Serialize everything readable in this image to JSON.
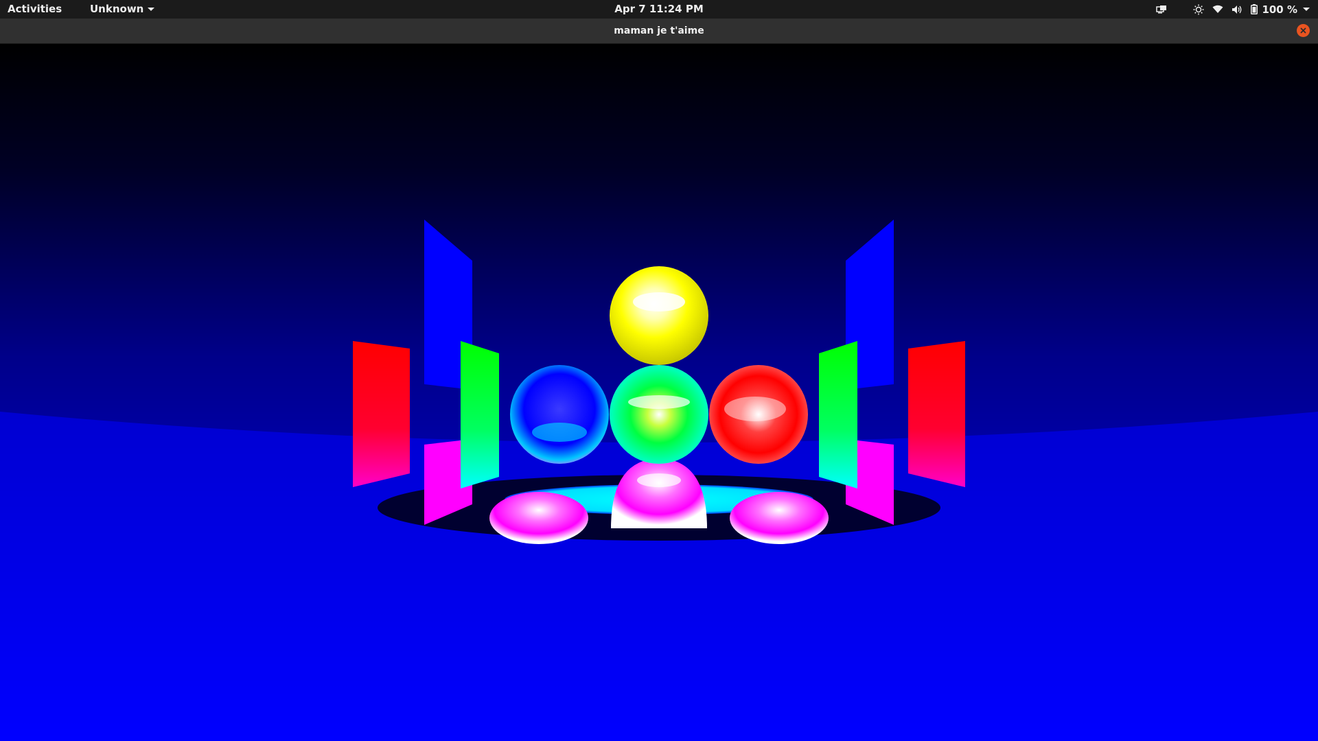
{
  "topbar": {
    "activities_label": "Activities",
    "app_menu_label": "Unknown",
    "clock": "Apr 7  11:24 PM",
    "battery_label": "100 %",
    "icons": [
      "screen-share-icon",
      "brightness-icon",
      "wifi-icon",
      "volume-icon",
      "battery-icon",
      "system-menu-chevron-icon"
    ]
  },
  "window": {
    "title": "maman je t'aime",
    "close_icon": "close-icon",
    "close_color": "#e95420"
  },
  "scene": {
    "floor_color": "#0000ff",
    "sky_color": "#000000",
    "spheres": [
      "yellow",
      "blue",
      "green",
      "red",
      "magenta"
    ],
    "panels": [
      "red",
      "blue",
      "green",
      "magenta"
    ]
  }
}
